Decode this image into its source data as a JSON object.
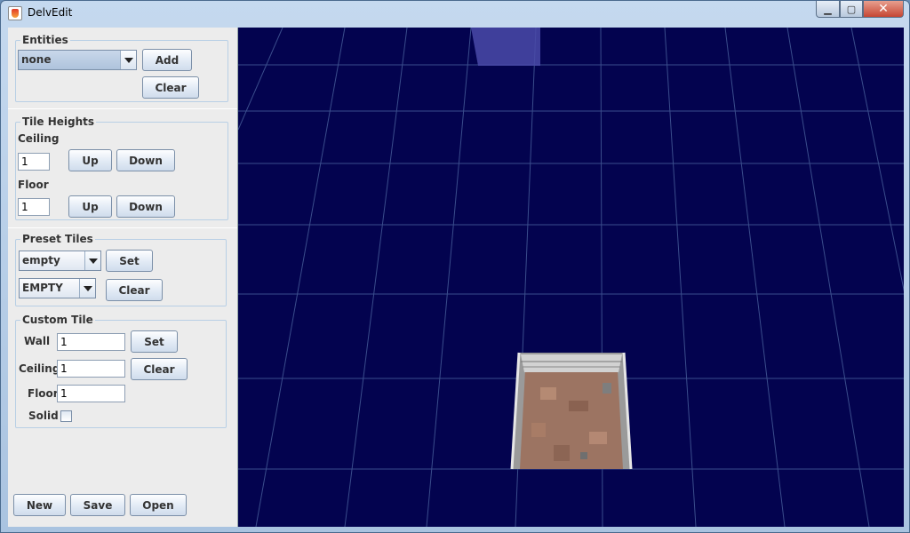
{
  "window": {
    "title": "DelvEdit",
    "min_label": "▁",
    "max_label": "▢",
    "close_label": "✕"
  },
  "entities": {
    "legend": "Entities",
    "selected": "none",
    "add_label": "Add",
    "clear_label": "Clear"
  },
  "tile_heights": {
    "legend": "Tile Heights",
    "ceiling_label": "Ceiling",
    "ceiling_value": "1",
    "floor_label": "Floor",
    "floor_value": "1",
    "up_label": "Up",
    "down_label": "Down"
  },
  "preset_tiles": {
    "legend": "Preset Tiles",
    "preset_selected": "empty",
    "type_selected": "EMPTY",
    "set_label": "Set",
    "clear_label": "Clear"
  },
  "custom_tile": {
    "legend": "Custom Tile",
    "wall_label": "Wall",
    "wall_value": "1",
    "ceiling_label": "Ceiling",
    "ceiling_value": "1",
    "floor_label": "Floor",
    "floor_value": "1",
    "solid_label": "Solid",
    "solid_checked": false,
    "set_label": "Set",
    "clear_label": "Clear"
  },
  "file_actions": {
    "new_label": "New",
    "save_label": "Save",
    "open_label": "Open"
  },
  "colors": {
    "viewport_bg": "#03034f",
    "grid_line": "#3a4d8c",
    "accent": "#7b8fa8"
  }
}
